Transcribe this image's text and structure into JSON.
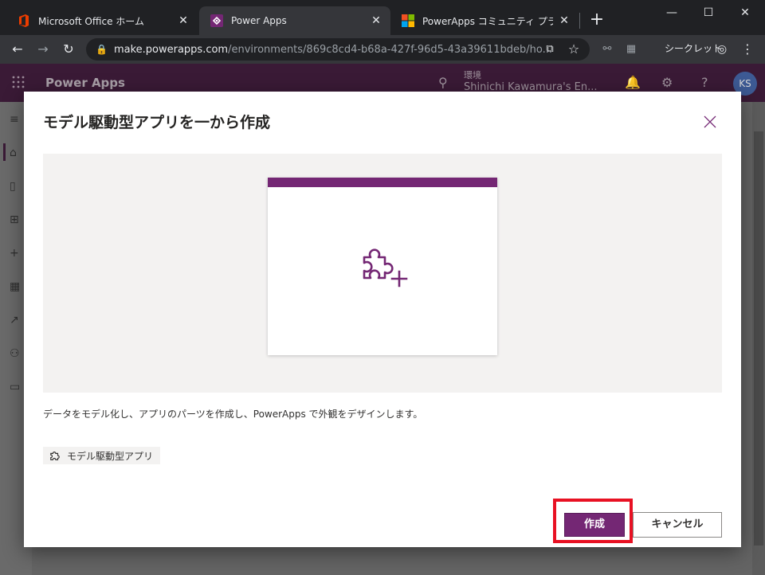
{
  "browser": {
    "tabs": [
      {
        "title": "Microsoft Office ホーム",
        "favicon": "office-icon",
        "active": false
      },
      {
        "title": "Power Apps",
        "favicon": "powerapps-icon",
        "active": true
      },
      {
        "title": "PowerApps コミュニティ プラン -- 個人",
        "favicon": "microsoft-icon",
        "active": false
      }
    ],
    "url_host": "make.powerapps.com",
    "url_path": "/environments/869c8cd4-b68a-427f-96d5-43a39611bdeb/ho...",
    "incognito_label": "シークレット"
  },
  "app_header": {
    "app_name": "Power Apps",
    "env_label": "環境",
    "env_name": "Shinichi Kawamura's En...",
    "avatar_initials": "KS"
  },
  "dialog": {
    "title": "モデル駆動型アプリを一から作成",
    "description": "データをモデル化し、アプリのパーツを作成し、PowerApps で外観をデザインします。",
    "tag_label": "モデル駆動型アプリ",
    "create_label": "作成",
    "cancel_label": "キャンセル"
  },
  "colors": {
    "brand_purple": "#742774",
    "highlight_red": "#e81123"
  }
}
